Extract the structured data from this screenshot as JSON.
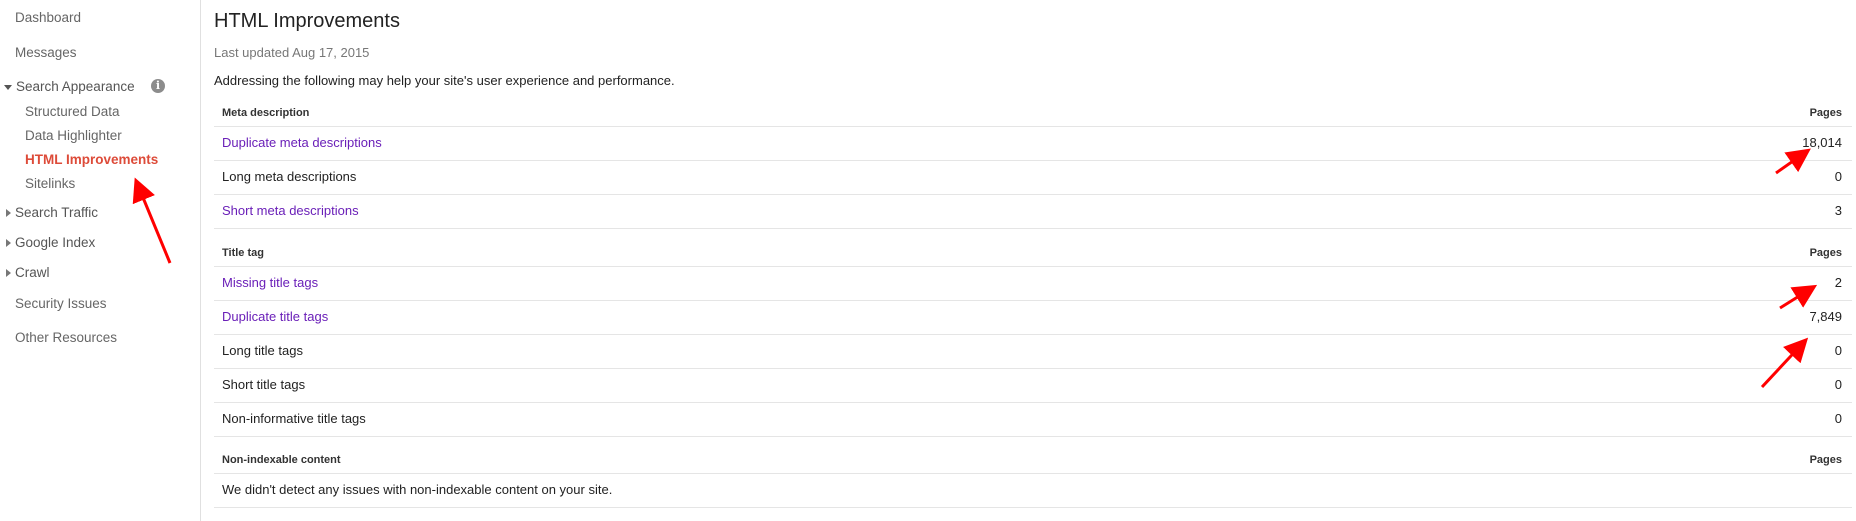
{
  "sidebar": {
    "dashboard": "Dashboard",
    "messages": "Messages",
    "search_appearance": "Search Appearance",
    "search_appearance_children": [
      "Structured Data",
      "Data Highlighter",
      "HTML Improvements",
      "Sitelinks"
    ],
    "search_traffic": "Search Traffic",
    "google_index": "Google Index",
    "crawl": "Crawl",
    "security_issues": "Security Issues",
    "other_resources": "Other Resources",
    "info_glyph": "i"
  },
  "main": {
    "title": "HTML Improvements",
    "last_updated": "Last updated Aug 17, 2015",
    "intro": "Addressing the following may help your site's user experience and performance.",
    "sections": [
      {
        "header": "Meta description",
        "pages_label": "Pages",
        "rows": [
          {
            "label": "Duplicate meta descriptions",
            "count": "18,014"
          },
          {
            "label": "Long meta descriptions",
            "count": "0"
          },
          {
            "label": "Short meta descriptions",
            "count": "3"
          }
        ]
      },
      {
        "header": "Title tag",
        "pages_label": "Pages",
        "rows": [
          {
            "label": "Missing title tags",
            "count": "2"
          },
          {
            "label": "Duplicate title tags",
            "count": "7,849"
          },
          {
            "label": "Long title tags",
            "count": "0"
          },
          {
            "label": "Short title tags",
            "count": "0"
          },
          {
            "label": "Non-informative title tags",
            "count": "0"
          }
        ]
      },
      {
        "header": "Non-indexable content",
        "pages_label": "Pages",
        "rows": [
          {
            "label": "We didn't detect any issues with non-indexable content on your site."
          }
        ]
      }
    ]
  },
  "colors": {
    "active_nav": "#dd4b39",
    "link": "#6a1fb8",
    "annotation_arrow": "#ff0000"
  }
}
